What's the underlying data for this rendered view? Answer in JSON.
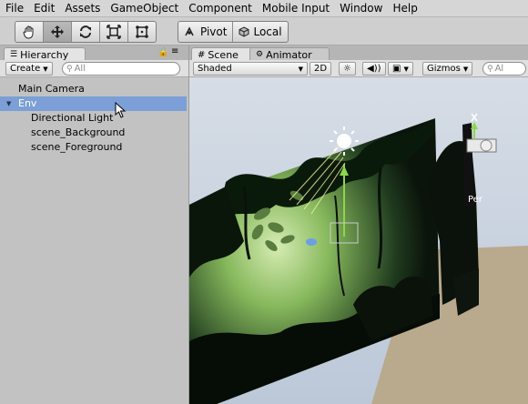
{
  "menubar": [
    "File",
    "Edit",
    "Assets",
    "GameObject",
    "Component",
    "Mobile Input",
    "Window",
    "Help"
  ],
  "toolbar": {
    "tools": [
      {
        "name": "hand-tool",
        "icon": "hand-icon"
      },
      {
        "name": "move-tool",
        "icon": "move-arrows-icon",
        "active": true
      },
      {
        "name": "rotate-tool",
        "icon": "rotate-icon"
      },
      {
        "name": "scale-tool",
        "icon": "scale-icon"
      },
      {
        "name": "rect-tool",
        "icon": "rect-icon"
      }
    ],
    "pivot_label": "Pivot",
    "local_label": "Local"
  },
  "hierarchy": {
    "tab_label": "Hierarchy",
    "create_label": "Create",
    "search_placeholder": "All",
    "items": [
      {
        "label": "Main Camera"
      },
      {
        "label": "Env",
        "selected": true
      },
      {
        "label": "Directional Light"
      },
      {
        "label": "scene_Background"
      },
      {
        "label": "scene_Foreground"
      }
    ]
  },
  "scene": {
    "tab_label": "Scene",
    "animator_tab_label": "Animator",
    "shading_mode": "Shaded",
    "mode_2d_label": "2D",
    "gizmos_label": "Gizmos",
    "search_placeholder": "Al",
    "camera_label": "Per"
  },
  "colors": {
    "selection": "#7b9fd6",
    "panel_bg": "#c2c2c2",
    "gizmo_green": "#8ed64c",
    "sky": "#c8d4e4"
  }
}
